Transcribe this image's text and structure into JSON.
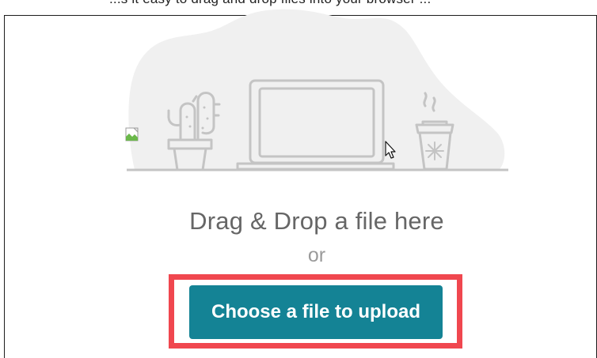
{
  "top_text": "...s it easy to drag and drop files into your browser ...",
  "dropzone": {
    "drop_label": "Drag & Drop a file here",
    "or_label": "or",
    "upload_button_label": "Choose a file to upload"
  },
  "colors": {
    "button_bg": "#148395",
    "highlight": "#f0474f",
    "drop_text": "#666666",
    "or_text": "#9a9a9a"
  },
  "icons": {
    "broken_image": "broken-image-icon",
    "cursor": "mouse-cursor-icon",
    "illustration": "desk-illustration"
  }
}
